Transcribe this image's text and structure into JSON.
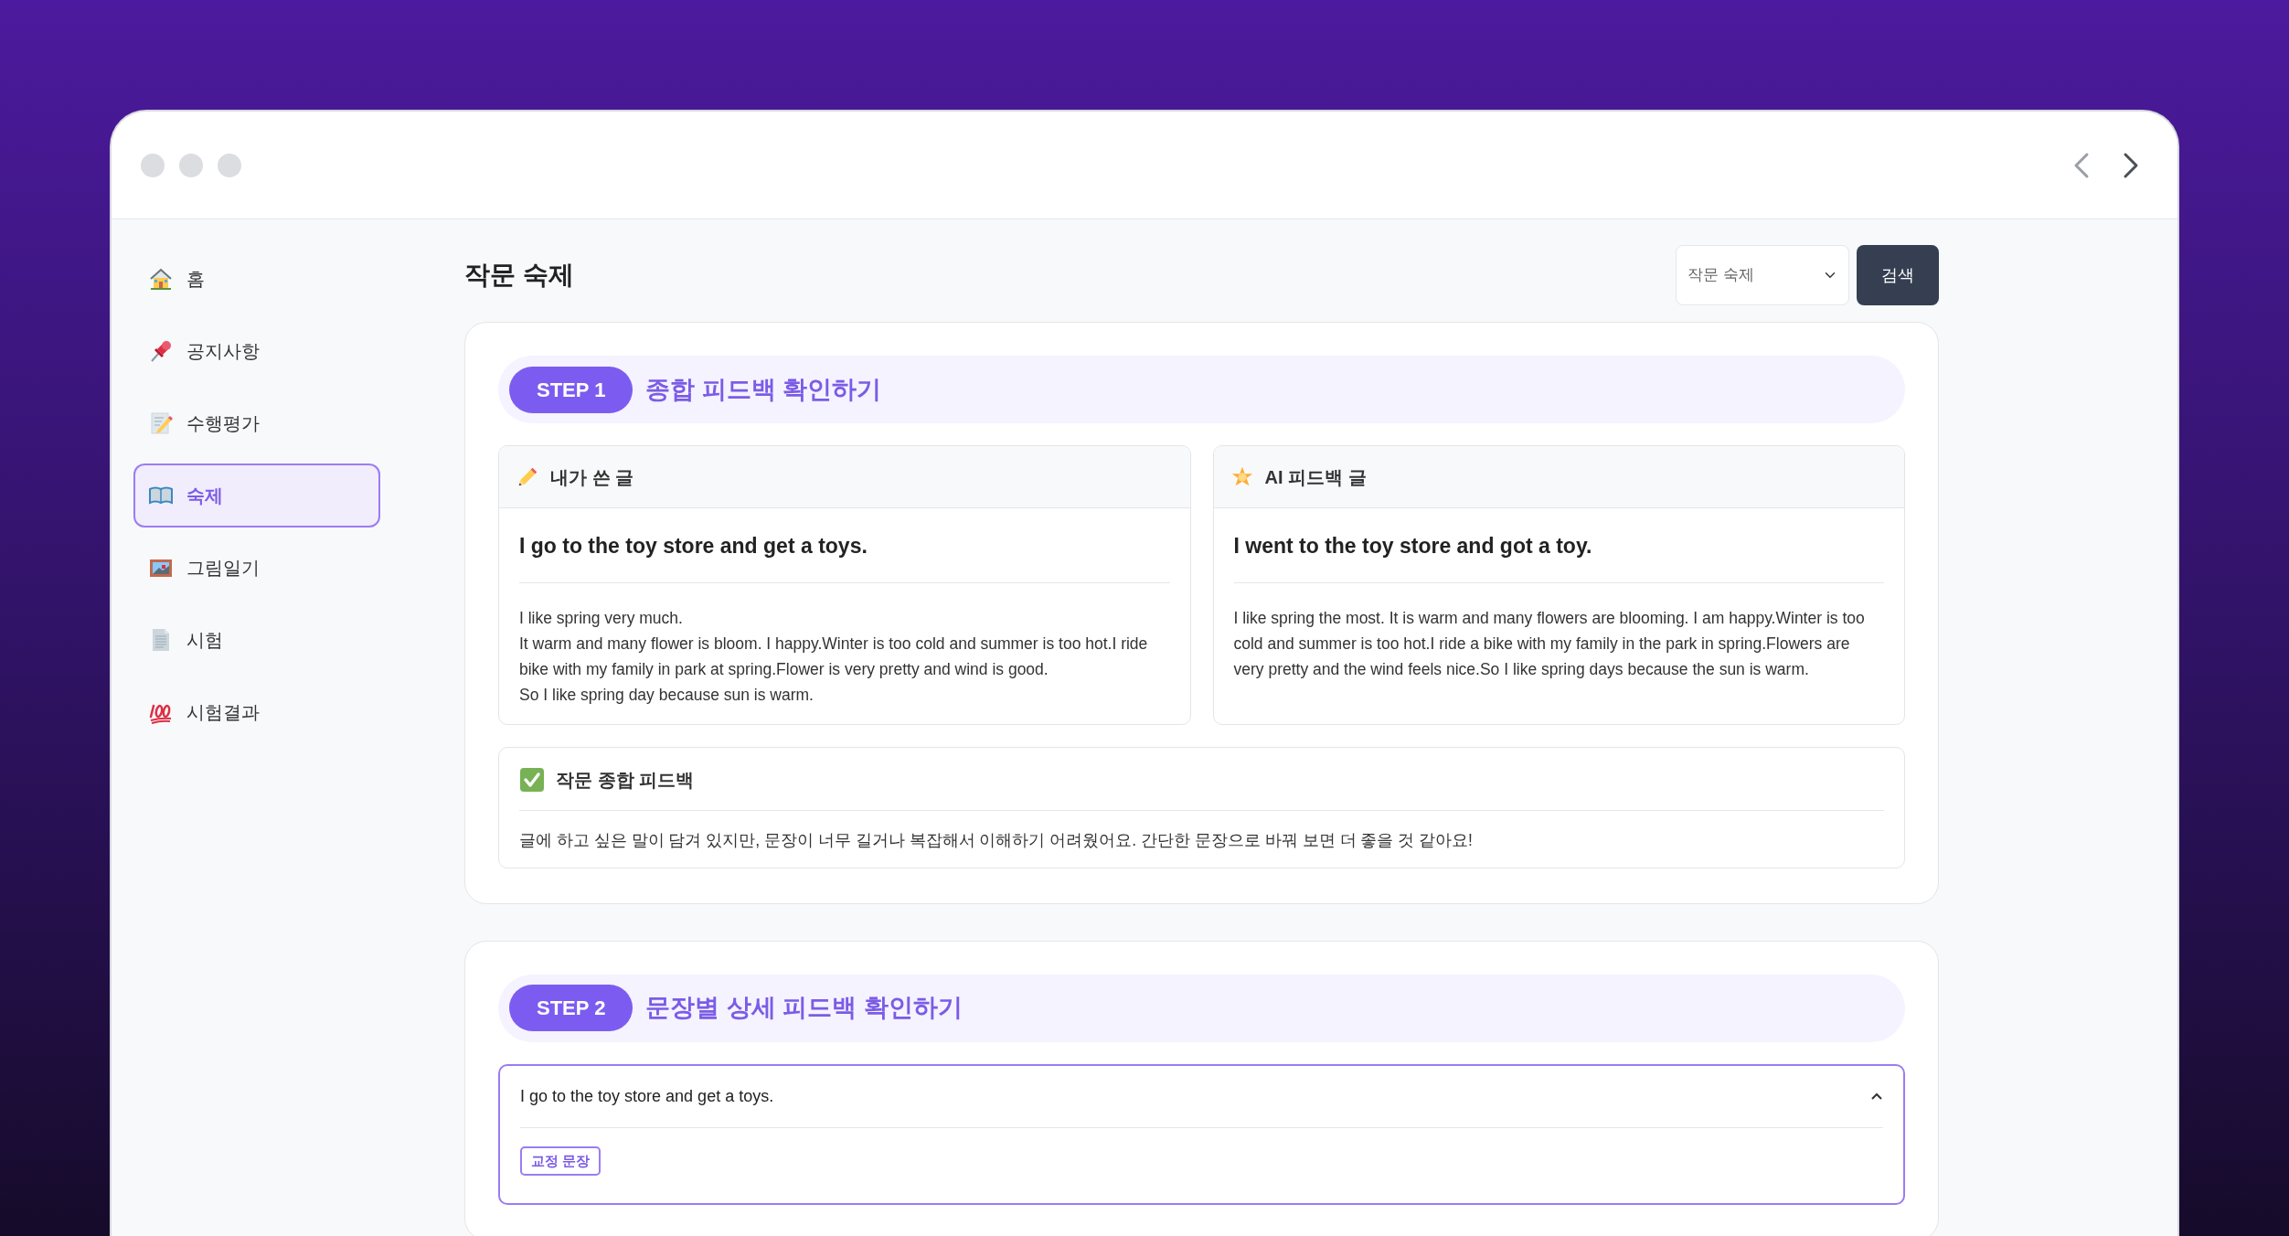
{
  "sidebar": {
    "items": [
      {
        "label": "홈",
        "selected": false
      },
      {
        "label": "공지사항",
        "selected": false
      },
      {
        "label": "수행평가",
        "selected": false
      },
      {
        "label": "숙제",
        "selected": true
      },
      {
        "label": "그림일기",
        "selected": false
      },
      {
        "label": "시험",
        "selected": false
      },
      {
        "label": "시험결과",
        "selected": false
      }
    ]
  },
  "header": {
    "title": "작문 숙제",
    "filter": {
      "value": "작문 숙제"
    },
    "search_button": "검색"
  },
  "step1": {
    "badge": "STEP 1",
    "title": "종합 피드백 확인하기",
    "panels": [
      {
        "kind": "original",
        "header": "내가 쓴 글",
        "headline": "I go to the toy store and get a toys.",
        "paragraphs": [
          "I like spring very much.",
          "It warm and many flower is bloom. I happy.Winter is too cold and summer is too hot.I ride bike with my family in park at spring.Flower is very pretty and wind is good.",
          "So I like spring day because sun is warm."
        ]
      },
      {
        "kind": "ai",
        "header": "AI 피드백 글",
        "headline": "I went to the toy store and got a toy.",
        "paragraphs": [
          "I like spring the most. It is warm and many flowers are blooming. I am happy.Winter is too cold and summer is too hot.I ride a bike with my family in the park in spring.Flowers are very pretty and the wind feels nice.So I like spring days because the sun is warm."
        ]
      }
    ],
    "summary": {
      "header": "작문 종합 피드백",
      "text": "글에 하고 싶은 말이 담겨 있지만, 문장이 너무 길거나 복잡해서 이해하기 어려웠어요. 간단한 문장으로 바꿔 보면 더 좋을 것 같아요!"
    }
  },
  "step2": {
    "badge": "STEP 2",
    "title": "문장별 상세 피드백 확인하기",
    "items": [
      {
        "sentence": "I go to the toy store and get a toys.",
        "expanded": true,
        "tag": "교정 문장"
      }
    ]
  }
}
